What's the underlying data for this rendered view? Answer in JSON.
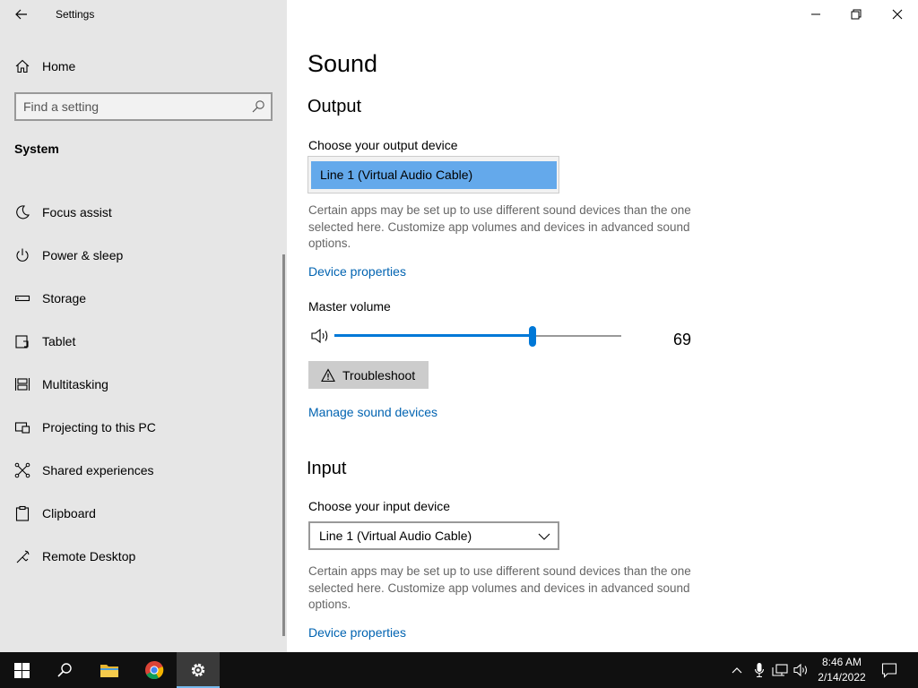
{
  "window": {
    "title": "Settings"
  },
  "sidebar": {
    "home_label": "Home",
    "search": {
      "placeholder": "Find a setting"
    },
    "section": "System",
    "items": [
      {
        "label": "Focus assist",
        "icon": "moon-icon"
      },
      {
        "label": "Power & sleep",
        "icon": "power-icon"
      },
      {
        "label": "Storage",
        "icon": "storage-icon"
      },
      {
        "label": "Tablet",
        "icon": "tablet-icon"
      },
      {
        "label": "Multitasking",
        "icon": "multitasking-icon"
      },
      {
        "label": "Projecting to this PC",
        "icon": "projecting-icon"
      },
      {
        "label": "Shared experiences",
        "icon": "shared-experiences-icon"
      },
      {
        "label": "Clipboard",
        "icon": "clipboard-icon"
      },
      {
        "label": "Remote Desktop",
        "icon": "remote-desktop-icon"
      }
    ]
  },
  "main": {
    "title": "Sound",
    "output": {
      "heading": "Output",
      "choose_label": "Choose your output device",
      "device": "Line 1 (Virtual Audio Cable)",
      "note": "Certain apps may be set up to use different sound devices than the one selected here. Customize app volumes and devices in advanced sound options.",
      "device_properties": "Device properties",
      "master_volume_label": "Master volume",
      "volume": 69,
      "volume_text": "69",
      "troubleshoot_label": "Troubleshoot",
      "manage_label": "Manage sound devices"
    },
    "input": {
      "heading": "Input",
      "choose_label": "Choose your input device",
      "device": "Line 1 (Virtual Audio Cable)",
      "note": "Certain apps may be set up to use different sound devices than the one selected here. Customize app volumes and devices in advanced sound options.",
      "device_properties": "Device properties"
    }
  },
  "taskbar": {
    "time": "8:46 AM",
    "date": "2/14/2022"
  },
  "colors": {
    "accent": "#0078d7",
    "link": "#0063b1",
    "selected_item": "#64a9eb",
    "sidebar_bg": "#e6e6e6",
    "taskbar_bg": "#101010"
  }
}
